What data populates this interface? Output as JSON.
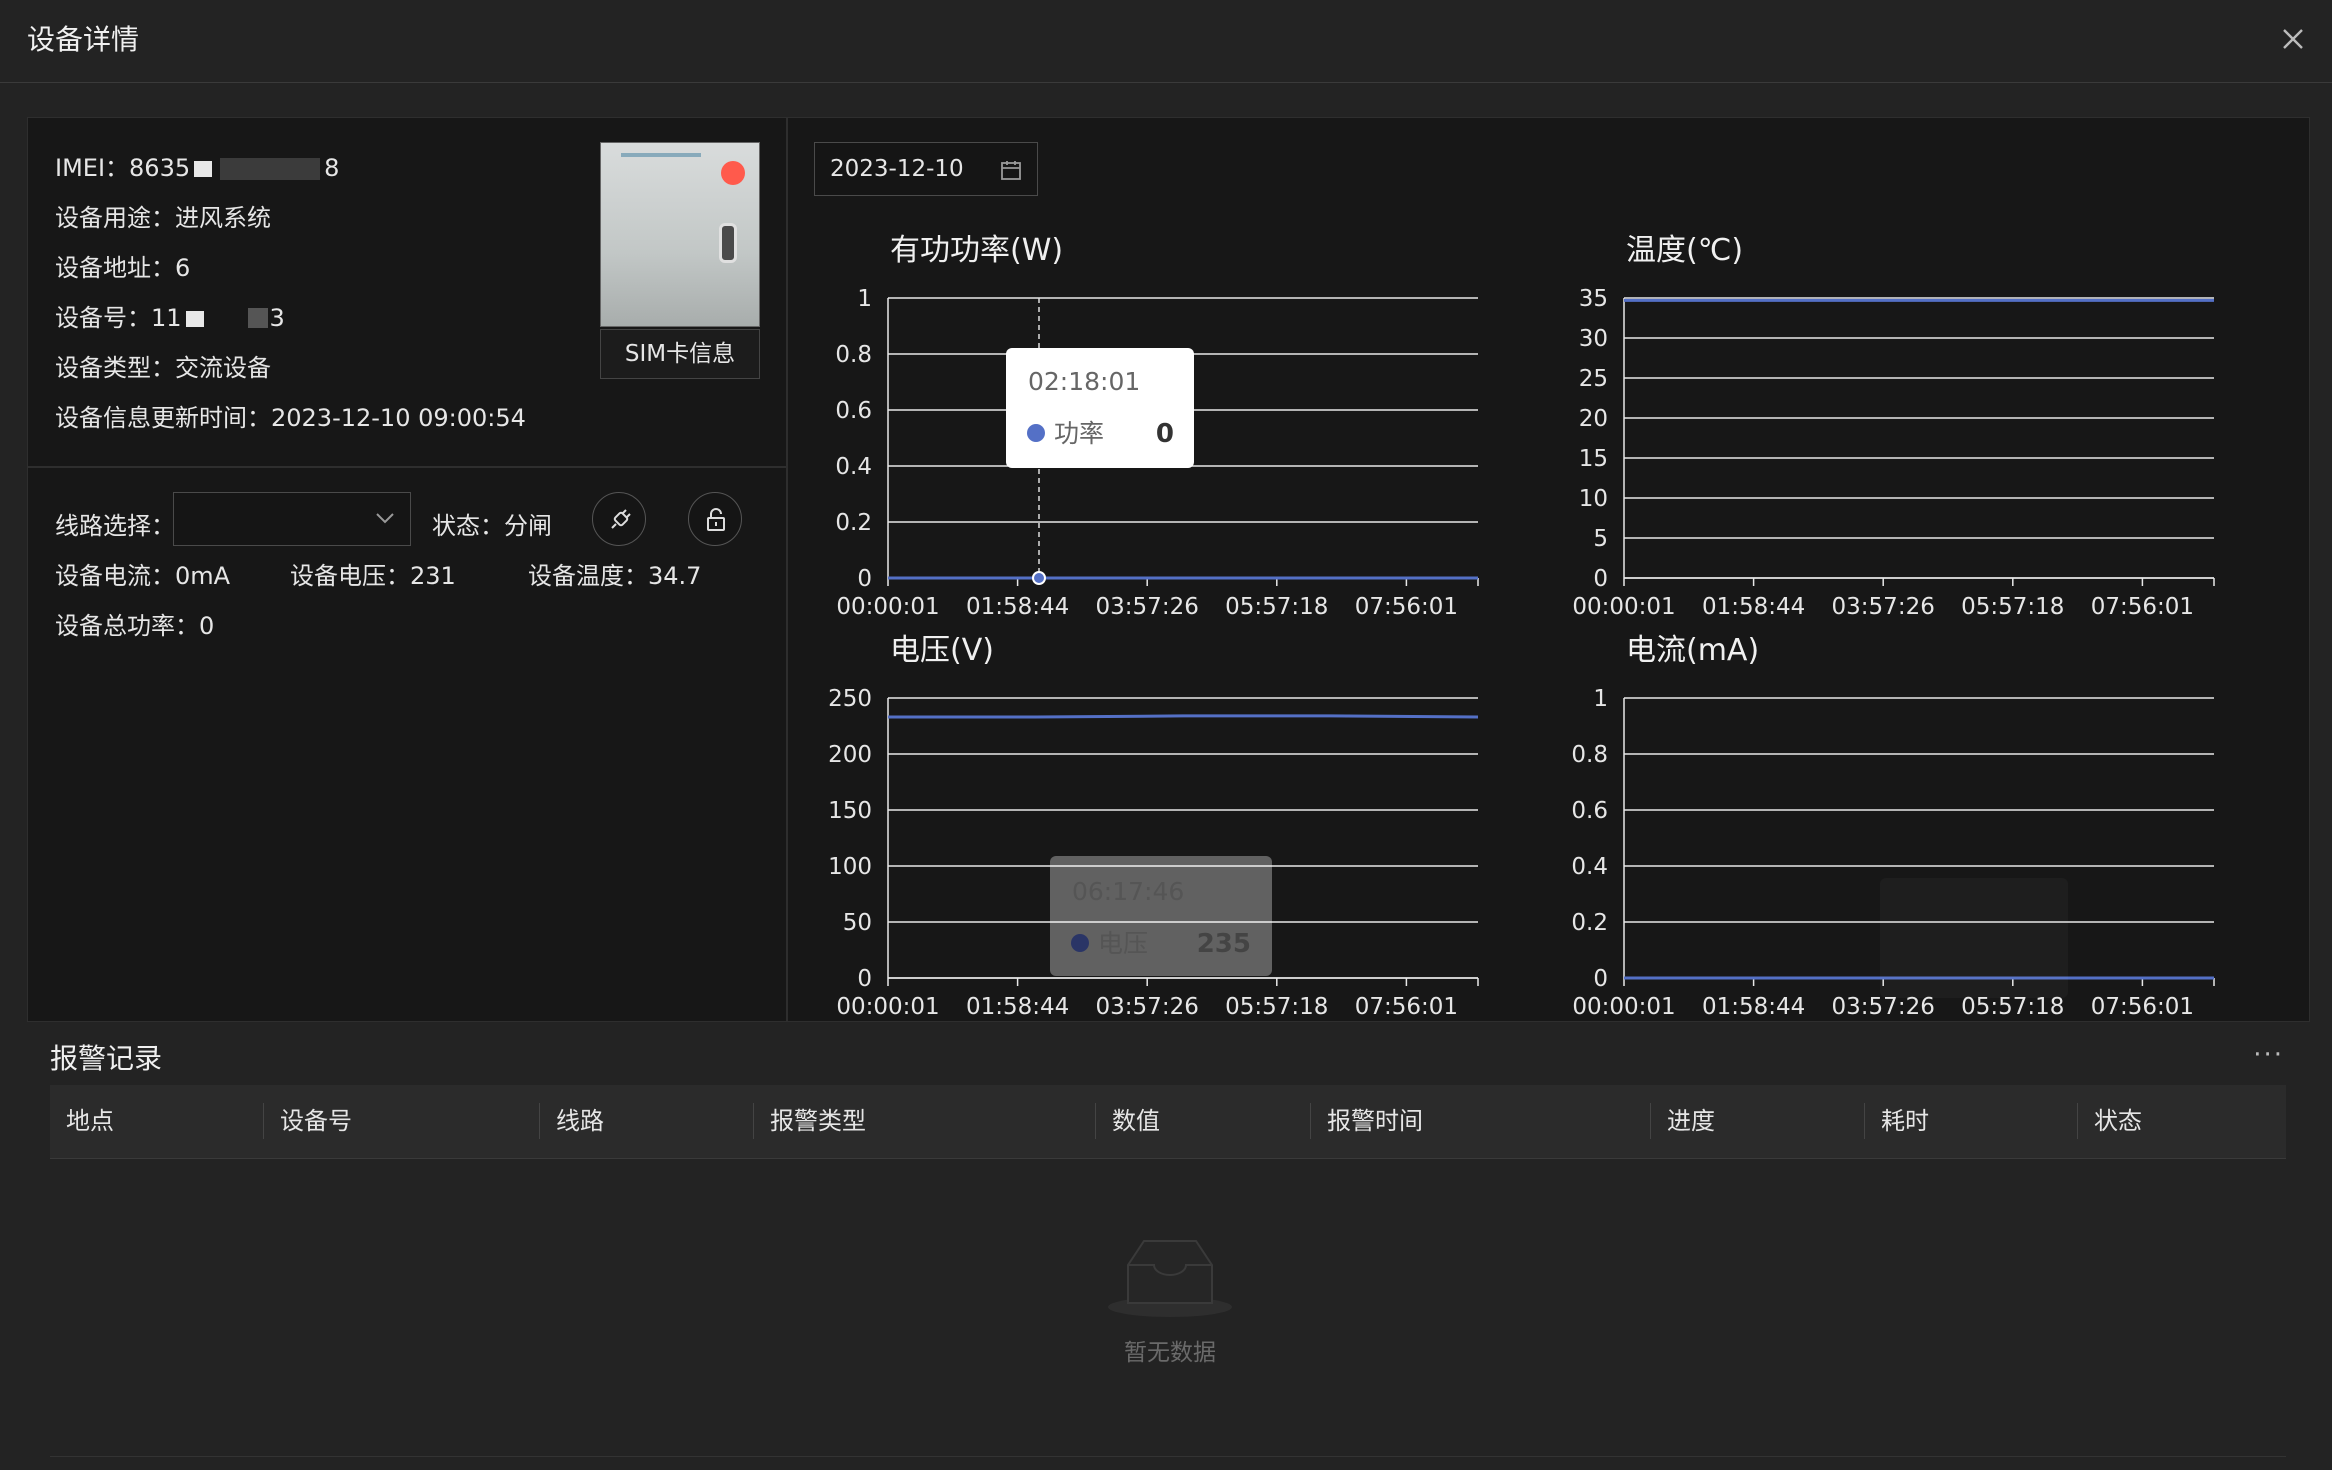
{
  "dialog": {
    "title": "设备详情"
  },
  "device": {
    "imei_label": "IMEI：",
    "imei_prefix": "8635",
    "imei_suffix": "8",
    "purpose": "设备用途：进风系统",
    "address": "设备地址：6",
    "number_label": "设备号：",
    "number_prefix": "11",
    "number_suffix": "3",
    "type": "设备类型：交流设备",
    "updated": "设备信息更新时间：2023-12-10 09:00:54",
    "sim_button": "SIM卡信息"
  },
  "line": {
    "select_label": "线路选择：",
    "select_value": "",
    "state": "状态：分闸",
    "current": "设备电流：0mA",
    "voltage": "设备电压：231",
    "temperature": "设备温度：34.7",
    "total_power": "设备总功率：0"
  },
  "date_picker": {
    "value": "2023-12-10",
    "icon": "calendar-icon"
  },
  "chart_data": [
    {
      "type": "line",
      "title": "有功功率(W)",
      "x": [
        "00:00:01",
        "01:58:44",
        "03:57:26",
        "05:57:18",
        "07:56:01"
      ],
      "ylim": [
        0,
        1
      ],
      "yticks": [
        "0",
        "0.2",
        "0.4",
        "0.6",
        "0.8",
        "1"
      ],
      "series": [
        {
          "name": "功率",
          "values": [
            0,
            0,
            0,
            0,
            0
          ]
        }
      ],
      "color": "#5470c6",
      "tooltip": {
        "time": "02:18:01",
        "name": "功率",
        "value": "0"
      }
    },
    {
      "type": "line",
      "title": "温度(℃)",
      "x": [
        "00:00:01",
        "01:58:44",
        "03:57:26",
        "05:57:18",
        "07:56:01"
      ],
      "ylim": [
        0,
        35
      ],
      "yticks": [
        "0",
        "5",
        "10",
        "15",
        "20",
        "25",
        "30",
        "35"
      ],
      "series": [
        {
          "values": [
            34.7,
            34.7,
            34.7,
            34.7,
            34.7
          ]
        }
      ],
      "color": "#5470c6"
    },
    {
      "type": "line",
      "title": "电压(V)",
      "x": [
        "00:00:01",
        "01:58:44",
        "03:57:26",
        "05:57:18",
        "07:56:01"
      ],
      "ylim": [
        0,
        250
      ],
      "yticks": [
        "0",
        "50",
        "100",
        "150",
        "200",
        "250"
      ],
      "series": [
        {
          "name": "电压",
          "values": [
            233,
            233,
            234,
            234,
            233
          ]
        }
      ],
      "color": "#5470c6",
      "tooltip": {
        "time": "06:17:46",
        "name": "电压",
        "value": "235"
      }
    },
    {
      "type": "line",
      "title": "电流(mA)",
      "x": [
        "00:00:01",
        "01:58:44",
        "03:57:26",
        "05:57:18",
        "07:56:01"
      ],
      "ylim": [
        0,
        1
      ],
      "yticks": [
        "0",
        "0.2",
        "0.4",
        "0.6",
        "0.8",
        "1"
      ],
      "series": [
        {
          "values": [
            0,
            0,
            0,
            0,
            0
          ]
        }
      ],
      "color": "#5470c6"
    }
  ],
  "alarms": {
    "title": "报警记录",
    "more": "···",
    "columns": [
      "地点",
      "设备号",
      "线路",
      "报警类型",
      "数值",
      "报警时间",
      "进度",
      "耗时",
      "状态"
    ],
    "empty_text": "暂无数据"
  }
}
